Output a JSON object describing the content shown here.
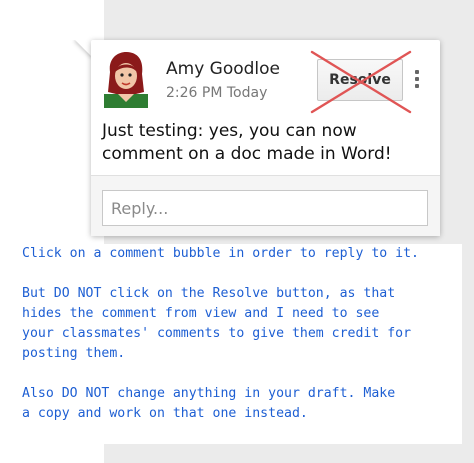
{
  "comment": {
    "author": "Amy Goodloe",
    "time": "2:26 PM Today",
    "resolve_label": "Resolve",
    "text": "Just testing: yes, you can now comment on a doc made in Word!",
    "reply_placeholder": "Reply..."
  },
  "instructions": {
    "line1": "Click on a comment bubble in order to reply to it.",
    "p2": [
      "But DO NOT click on the Resolve button, as that",
      "hides the comment from view and I need to see",
      "your classmates' comments to give them credit for",
      "posting them."
    ],
    "p3": [
      "Also DO NOT change anything in your draft.  Make",
      "a copy and work on that one instead."
    ]
  },
  "colors": {
    "instruction_text": "#1e5fd3",
    "strike_x": "#e05555",
    "panel_bg": "#ebebeb"
  },
  "icons": {
    "more": "more-vertical-icon",
    "avatar": "avatar-icon"
  }
}
